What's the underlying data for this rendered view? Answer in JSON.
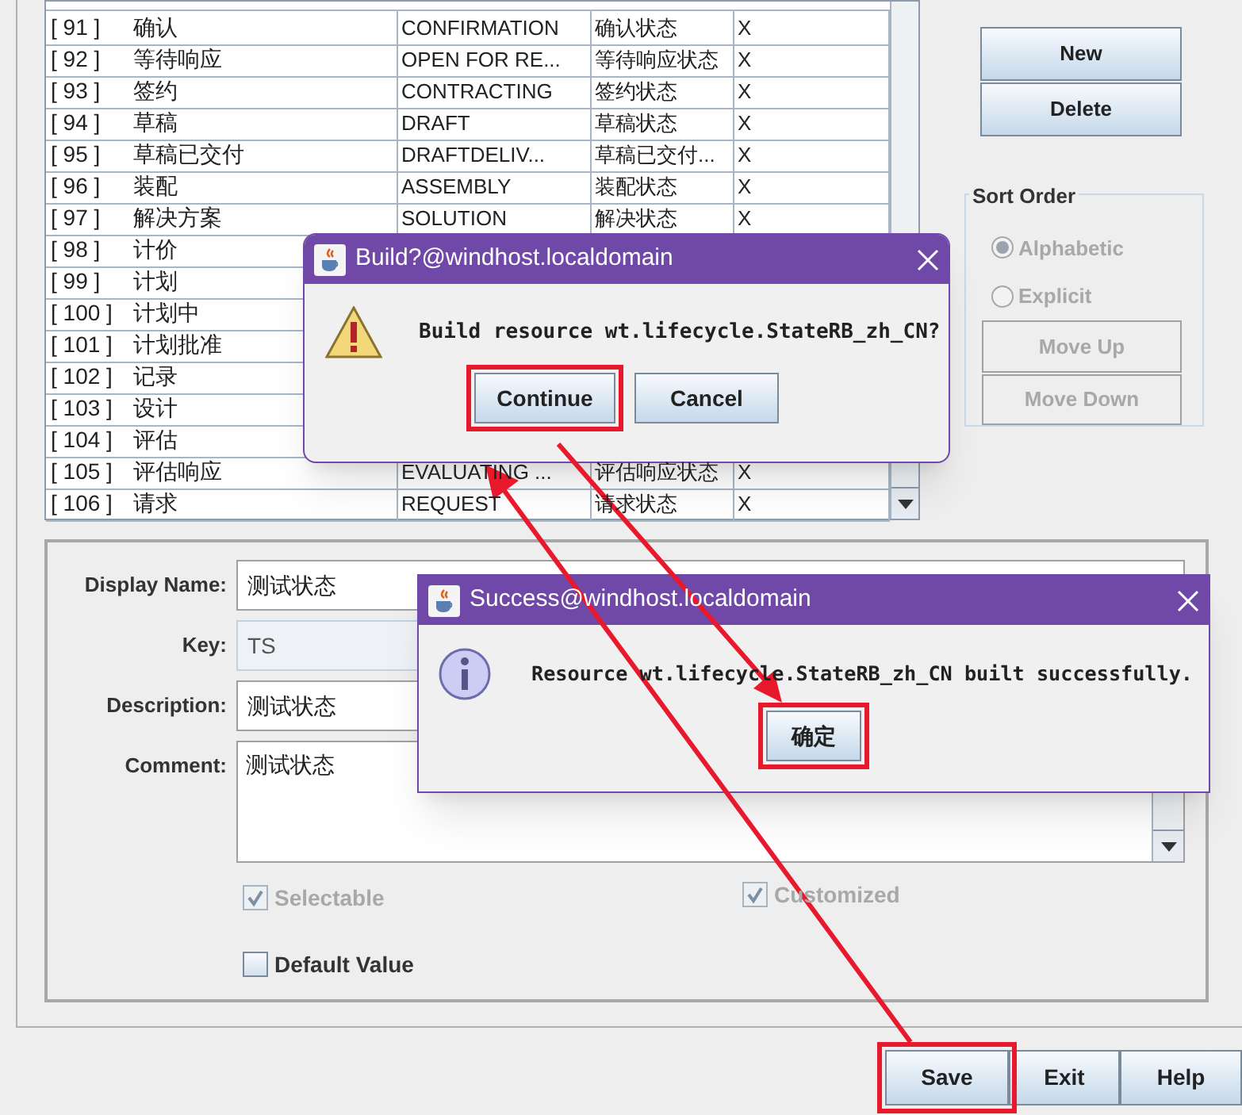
{
  "table": {
    "rows": [
      {
        "index": "[ 91 ]",
        "name": "确认",
        "key": "CONFIRMATION",
        "description": "确认状态",
        "column_4": "X"
      },
      {
        "index": "[ 92 ]",
        "name": "等待响应",
        "key": "OPEN FOR RE...",
        "description": "等待响应状态",
        "column_4": "X"
      },
      {
        "index": "[ 93 ]",
        "name": "签约",
        "key": "CONTRACTING",
        "description": "签约状态",
        "column_4": "X"
      },
      {
        "index": "[ 94 ]",
        "name": "草稿",
        "key": "DRAFT",
        "description": "草稿状态",
        "column_4": "X"
      },
      {
        "index": "[ 95 ]",
        "name": "草稿已交付",
        "key": "DRAFTDELIV...",
        "description": "草稿已交付...",
        "column_4": "X"
      },
      {
        "index": "[ 96 ]",
        "name": "装配",
        "key": "ASSEMBLY",
        "description": "装配状态",
        "column_4": "X"
      },
      {
        "index": "[ 97 ]",
        "name": "解决方案",
        "key": "SOLUTION",
        "description": "解决状态",
        "column_4": "X"
      },
      {
        "index": "[ 98 ]",
        "name": "计价"
      },
      {
        "index": "[ 99 ]",
        "name": "计划"
      },
      {
        "index": "[ 100 ]",
        "name": "计划中"
      },
      {
        "index": "[ 101 ]",
        "name": "计划批准"
      },
      {
        "index": "[ 102 ]",
        "name": "记录"
      },
      {
        "index": "[ 103 ]",
        "name": "设计"
      },
      {
        "index": "[ 104 ]",
        "name": "评估"
      },
      {
        "index": "[ 105 ]",
        "name": "评估响应",
        "key": "EVALUATING ...",
        "description": "评估响应状态",
        "column_4": "X"
      },
      {
        "index": "[ 106 ]",
        "name": "请求",
        "key": "REQUEST",
        "description": "请求状态",
        "column_4": "X"
      }
    ]
  },
  "right_panel": {
    "buttons": [
      {
        "label": "New"
      },
      {
        "label": "Delete"
      }
    ],
    "sort_order": {
      "title": "Sort Order",
      "options": [
        {
          "label": "Alphabetic",
          "selected": true,
          "disabled": true
        },
        {
          "label": "Explicit",
          "selected": false,
          "disabled": true
        }
      ],
      "buttons": [
        {
          "label": "Move Up",
          "disabled": true
        },
        {
          "label": "Move Down",
          "disabled": true
        }
      ]
    }
  },
  "form": {
    "fields": [
      {
        "label": "Display Name:",
        "value": "测试状态",
        "kind": "text",
        "disabled": false
      },
      {
        "label": "Key:",
        "value": "TS",
        "kind": "text",
        "disabled": true
      },
      {
        "label": "Description:",
        "value": "测试状态",
        "kind": "text",
        "disabled": false
      },
      {
        "label": "Comment:",
        "value": "测试状态",
        "kind": "textarea",
        "disabled": false
      }
    ],
    "checkboxes": [
      {
        "label": "Selectable",
        "checked": true,
        "disabled": true
      },
      {
        "label": "Customized",
        "checked": true,
        "disabled": true
      },
      {
        "label": "Default Value",
        "checked": false,
        "disabled": false
      }
    ]
  },
  "buttons": [
    {
      "label": "Save",
      "highlighted": true
    },
    {
      "label": "Exit",
      "highlighted": false
    },
    {
      "label": "Help",
      "highlighted": false
    }
  ],
  "dialogs": [
    {
      "title": "Build?@windhost.localdomain",
      "kind": "warning",
      "message": "Build resource wt.lifecycle.StateRB_zh_CN?",
      "buttons": [
        {
          "label": "Continue",
          "highlighted": true
        },
        {
          "label": "Cancel",
          "highlighted": false
        }
      ]
    },
    {
      "title": "Success@windhost.localdomain",
      "kind": "info",
      "message": "Resource wt.lifecycle.StateRB_zh_CN built successfully.",
      "buttons": [
        {
          "label": "确定",
          "highlighted": true
        }
      ]
    }
  ]
}
